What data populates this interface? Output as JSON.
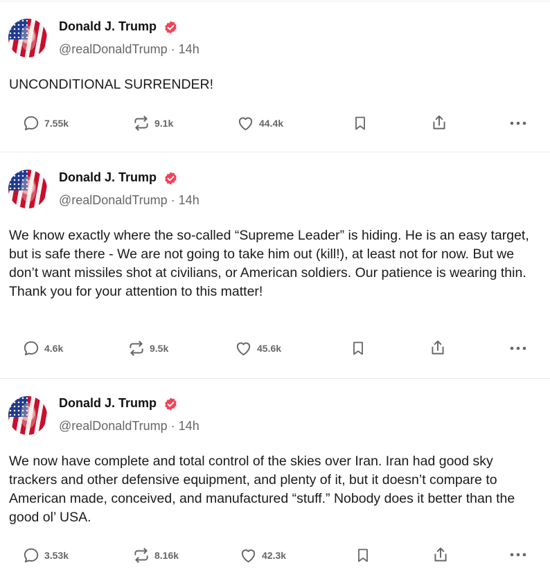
{
  "posts": [
    {
      "author": "Donald J. Trump",
      "handle": "@realDonaldTrump",
      "time": "14h",
      "text": "UNCONDITIONAL SURRENDER!",
      "replies": "7.55k",
      "reposts": "9.1k",
      "likes": "44.4k"
    },
    {
      "author": "Donald J. Trump",
      "handle": "@realDonaldTrump",
      "time": "14h",
      "text": "We know exactly where the so-called “Supreme Leader” is hiding. He is an easy target, but is safe there - We are not going to take him out (kill!), at least not for now. But we don’t want missiles shot at civilians, or American soldiers. Our patience is wearing thin. Thank you for your attention to this matter!",
      "replies": "4.6k",
      "reposts": "9.5k",
      "likes": "45.6k"
    },
    {
      "author": "Donald J. Trump",
      "handle": "@realDonaldTrump",
      "time": "14h",
      "text": "We now have complete and total control of the skies over Iran. Iran had good sky trackers and other defensive equipment, and plenty of it, but it doesn’t compare to American made, conceived, and manufactured “stuff.” Nobody does it better than the good ol’ USA.",
      "replies": "3.53k",
      "reposts": "8.16k",
      "likes": "42.3k"
    }
  ],
  "colors": {
    "verified_badge": "#f0445a",
    "icon_gray": "#666666",
    "text": "#1a1a1a",
    "divider": "#ececec"
  },
  "icons": {
    "reply": "speech-bubble-icon",
    "repost": "repost-arrows-icon",
    "like": "heart-icon",
    "bookmark": "bookmark-icon",
    "share": "share-upload-icon",
    "more": "more-dots-icon",
    "verified": "verified-badge-icon"
  }
}
